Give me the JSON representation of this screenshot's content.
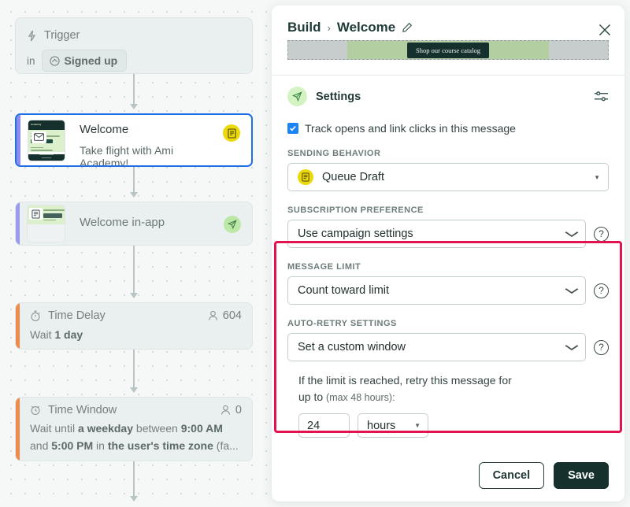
{
  "canvas": {
    "trigger": {
      "icon": "lightning-icon",
      "title": "Trigger",
      "preposition": "in",
      "chip_label": "Signed up",
      "chip_icon": "segment-icon"
    },
    "nodes": [
      {
        "id": "welcome-email",
        "title": "Welcome",
        "subtitle": "Take flight with Ami Academy!",
        "badge_icon": "draft-document-icon",
        "selected": true
      },
      {
        "id": "welcome-in-app",
        "title": "Welcome in-app",
        "badge_icon": "send-paper-plane-icon",
        "selected": false
      },
      {
        "id": "time-delay",
        "title": "Time Delay",
        "icon": "stopwatch-icon",
        "people_icon": "person-icon",
        "people_count": "604",
        "detail_prefix": "Wait ",
        "detail_bold": "1 day"
      },
      {
        "id": "time-window",
        "title": "Time Window",
        "icon": "clock-window-icon",
        "people_icon": "person-icon",
        "people_count": "0",
        "line1_a": "Wait until ",
        "line1_b": "a weekday",
        "line1_c": " between ",
        "line1_d": "9:00 AM",
        "line2_a": "and ",
        "line2_b": "5:00 PM",
        "line2_c": " in ",
        "line2_d": "the user's time zone",
        "line2_e": " (fa..."
      }
    ]
  },
  "panel": {
    "breadcrumb_root": "Build",
    "breadcrumb_separator": "›",
    "breadcrumb_current": "Welcome",
    "edit_icon": "pencil-icon",
    "close_icon": "close-x-icon",
    "preview": {
      "button_label": "Shop our course catalog"
    },
    "settings": {
      "icon": "send-paper-plane-icon",
      "title": "Settings",
      "options_icon": "sliders-icon"
    },
    "track_checkbox": {
      "checked": true,
      "label": "Track opens and link clicks in this message"
    },
    "sending_behavior": {
      "label": "SENDING BEHAVIOR",
      "value": "Queue Draft",
      "value_icon": "draft-document-icon"
    },
    "subscription_preference": {
      "label": "SUBSCRIPTION PREFERENCE",
      "value": "Use campaign settings",
      "help_icon": "question-mark-icon"
    },
    "message_limit": {
      "label": "MESSAGE LIMIT",
      "value": "Count toward limit",
      "help_icon": "question-mark-icon"
    },
    "auto_retry": {
      "label": "AUTO-RETRY SETTINGS",
      "value": "Set a custom window",
      "help_icon": "question-mark-icon",
      "description_line1": "If the limit is reached, retry this message for",
      "description_line2_a": "up to ",
      "description_line2_b": "(max 48 hours):",
      "amount_value": "24",
      "unit_value": "hours"
    },
    "footer": {
      "cancel_label": "Cancel",
      "save_label": "Save"
    },
    "highlight_color": "#e31350"
  }
}
